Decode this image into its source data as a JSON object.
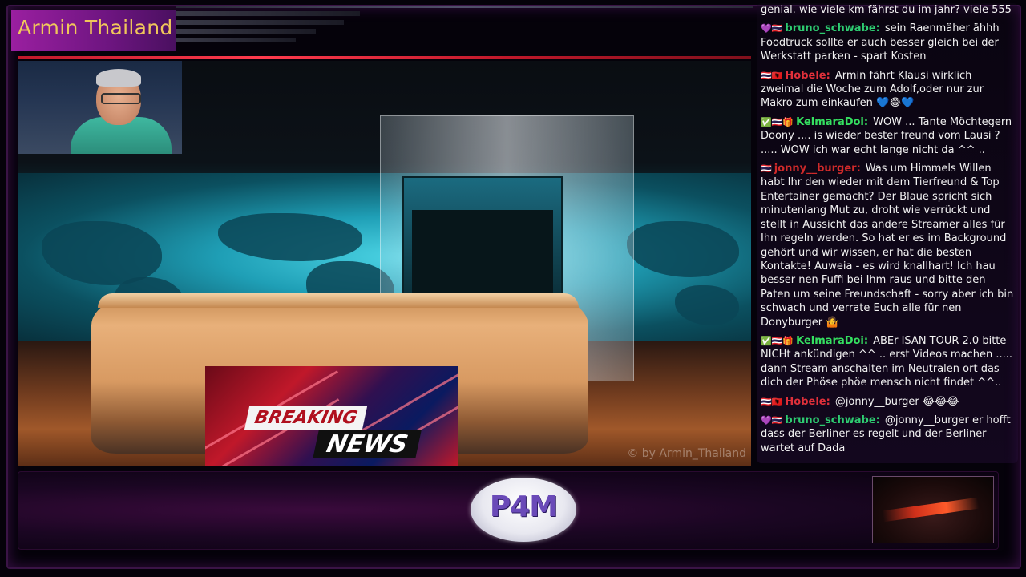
{
  "stream": {
    "channel_title": "Armin Thailand",
    "watermark": "© by Armin_Thailand"
  },
  "breaking_news": {
    "label_top": "BREAKING",
    "label_bottom": "NEWS"
  },
  "logo": {
    "text": "P4M"
  },
  "chat": {
    "messages": [
      {
        "badges": "",
        "user": "",
        "user_color": "",
        "text": "genial. wie viele km fährst du im jahr? viele 555"
      },
      {
        "badges": "💜🇹🇭",
        "user": "bruno_schwabe",
        "user_color": "#2ecc71",
        "text": "sein Raenmäher ähhh Foodtruck sollte er auch besser gleich bei der Werkstatt parken - spart Kosten"
      },
      {
        "badges": "🇹🇭🇦🇱",
        "user": "Hobele",
        "user_color": "#e0303a",
        "text": "Armin fährt Klausi wirklich zweimal die Woche zum Adolf,oder nur zur Makro zum einkaufen 💙😂💙"
      },
      {
        "badges": "✅🇹🇭🎁",
        "user": "KelmaraDoi",
        "user_color": "#35e060",
        "text": "WOW ... Tante Möchtegern Doony .... is wieder bester freund vom Lausi ? ..... WOW ich war echt lange nicht da ^^ .."
      },
      {
        "badges": "🇹🇭",
        "user": "jonny__burger",
        "user_color": "#d02a2a",
        "text": "Was um Himmels Willen habt Ihr den wieder mit dem Tierfreund & Top Entertainer gemacht? Der Blaue spricht sich minutenlang Mut zu, droht wie verrückt und stellt in Aussicht das andere Streamer alles für Ihn regeln werden. So hat er es im Background gehört und wir wissen, er hat die besten Kontakte! Auweia - es wird knallhart! Ich hau besser nen Fuffi bei Ihm raus und bitte den Paten um seine Freundschaft - sorry aber ich bin schwach und verrate Euch alle für nen Donyburger 🤷"
      },
      {
        "badges": "✅🇹🇭🎁",
        "user": "KelmaraDoi",
        "user_color": "#35e060",
        "text": "ABEr ISAN TOUR 2.0 bitte NICHt ankündigen ^^ .. erst Videos machen ..... dann Stream anschalten im Neutralen ort das dich der Phöse phöe mensch nicht findet ^^.."
      },
      {
        "badges": "🇹🇭🇦🇱",
        "user": "Hobele",
        "user_color": "#e0303a",
        "text": "@jonny__burger 😂😂😂"
      },
      {
        "badges": "💜🇹🇭",
        "user": "bruno_schwabe",
        "user_color": "#2ecc71",
        "text": "@jonny__burger er hofft dass der Berliner es regelt und der Berliner wartet auf Dada"
      }
    ]
  },
  "colors": {
    "accent_purple": "#9a1fa0",
    "title_gold": "#f0c75a",
    "accent_red": "#c0182a"
  }
}
